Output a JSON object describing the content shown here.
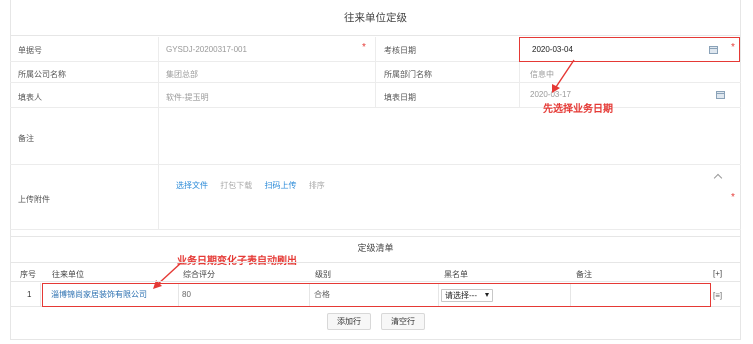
{
  "form": {
    "title": "往来单位定级",
    "fields": {
      "doc_no_label": "单据号",
      "doc_no_value": "GYSDJ-20200317-001",
      "eval_date_label": "考核日期",
      "eval_date_value": "2020-03-04",
      "company_label": "所属公司名称",
      "company_value": "集团总部",
      "dept_label": "所属部门名称",
      "dept_value": "信息中",
      "filler_label": "填表人",
      "filler_value": "软件-提玉明",
      "fill_date_label": "填表日期",
      "fill_date_value": "2020-03-17",
      "remark_label": "备注",
      "attach_label": "上传附件"
    },
    "required_mark": "*",
    "upload": {
      "select_file": "选择文件",
      "pack_download": "打包下载",
      "scan_upload": "扫码上传",
      "sort": "排序"
    }
  },
  "annotations": {
    "select_date_hint": "先选择业务日期",
    "refresh_hint": "业务日期变化子表自动刷出"
  },
  "grid": {
    "title": "定级清单",
    "headers": [
      "序号",
      "往来单位",
      "综合评分",
      "级别",
      "黑名单",
      "备注"
    ],
    "add_row_icon": "[+]",
    "row_menu_icon": "[≡]",
    "rows": [
      {
        "index": "1",
        "unit": "淄博锦尚家居装饰有限公司",
        "score": "80",
        "level": "合格",
        "blacklist": "请选择---",
        "remark": ""
      }
    ],
    "add_row_button": "添加行",
    "clear_rows_button": "清空行"
  },
  "colors": {
    "accent_red": "#e53935",
    "link_blue": "#2a8ad8"
  }
}
